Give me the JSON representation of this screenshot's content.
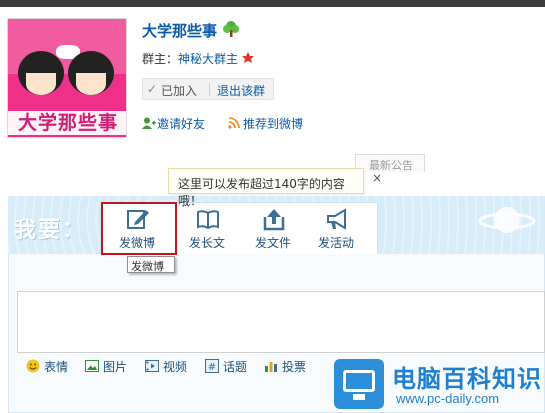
{
  "group": {
    "name": "大学那些事",
    "avatar_text": "大学那些事",
    "owner_label": "群主：",
    "owner_name": "神秘大群主",
    "joined_label": "已加入",
    "quit_label": "退出该群",
    "invite_label": "邀请好友",
    "recommend_label": "推荐到微博"
  },
  "notice": {
    "tab_label": "最新公告",
    "tooltip_text": "这里可以发布超过140字的内容哦！",
    "close_glyph": "×"
  },
  "composer": {
    "heading": "我要：",
    "tabs": [
      {
        "label": "发微博",
        "icon": "pencil-icon"
      },
      {
        "label": "发长文",
        "icon": "book-icon"
      },
      {
        "label": "发文件",
        "icon": "upload-icon"
      },
      {
        "label": "发活动",
        "icon": "megaphone-icon"
      }
    ],
    "hover_tooltip": "发微博",
    "toolbar": [
      {
        "label": "表情",
        "icon": "emoji-icon"
      },
      {
        "label": "图片",
        "icon": "image-icon"
      },
      {
        "label": "视频",
        "icon": "video-icon"
      },
      {
        "label": "话题",
        "icon": "topic-icon"
      },
      {
        "label": "投票",
        "icon": "vote-icon"
      }
    ]
  },
  "watermark": {
    "title": "电脑百科知识",
    "url": "www.pc-daily.com"
  },
  "colors": {
    "link": "#0a5aa8",
    "highlight": "#c0161c",
    "action_bar": "#d6ecf8"
  }
}
